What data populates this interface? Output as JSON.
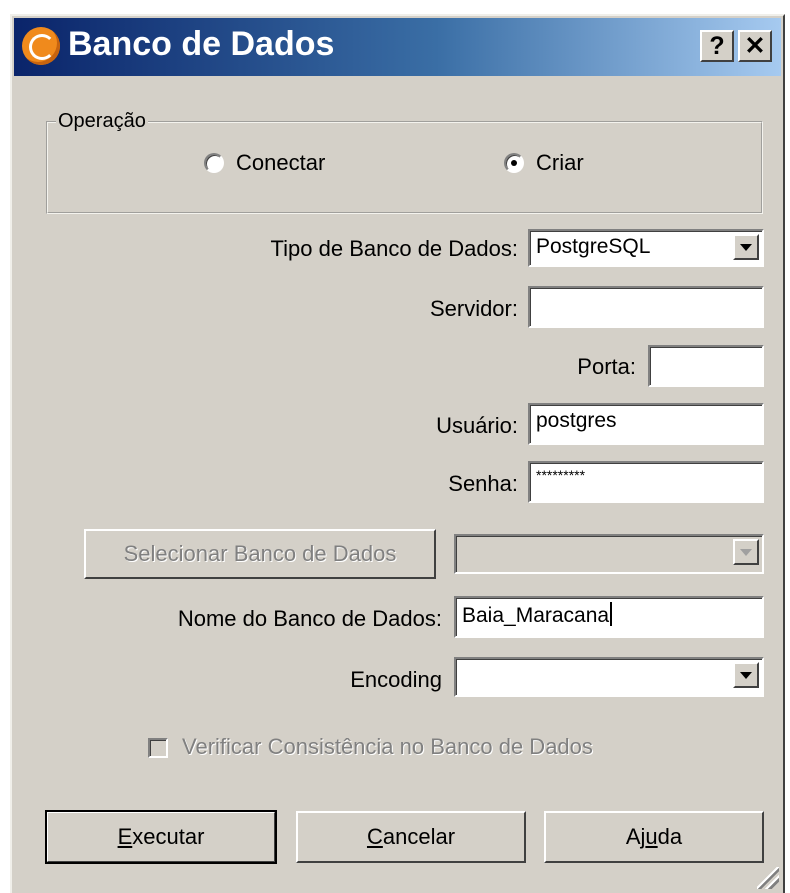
{
  "window": {
    "title": "Banco de Dados",
    "help_button": "?",
    "close_button": "✕"
  },
  "operation": {
    "legend": "Operação",
    "options": [
      {
        "label": "Conectar",
        "selected": false
      },
      {
        "label": "Criar",
        "selected": true
      }
    ]
  },
  "form": {
    "db_type_label": "Tipo de Banco de Dados:",
    "db_type_value": "PostgreSQL",
    "server_label": "Servidor:",
    "server_value": "",
    "port_label": "Porta:",
    "port_value": "",
    "user_label": "Usuário:",
    "user_value": "postgres",
    "password_label": "Senha:",
    "password_value": "*********",
    "select_db_button": "Selecionar Banco de Dados",
    "select_db_value": "",
    "db_name_label": "Nome do Banco de Dados:",
    "db_name_value": "Baia_Maracana",
    "encoding_label": "Encoding",
    "encoding_value": "",
    "verify_label": "Verificar Consistência no Banco de Dados",
    "verify_checked": false
  },
  "buttons": {
    "execute_access": "E",
    "execute_rest": "xecutar",
    "cancel_access": "C",
    "cancel_rest": "ancelar",
    "help_pre": "Aj",
    "help_access": "u",
    "help_post": "da"
  }
}
